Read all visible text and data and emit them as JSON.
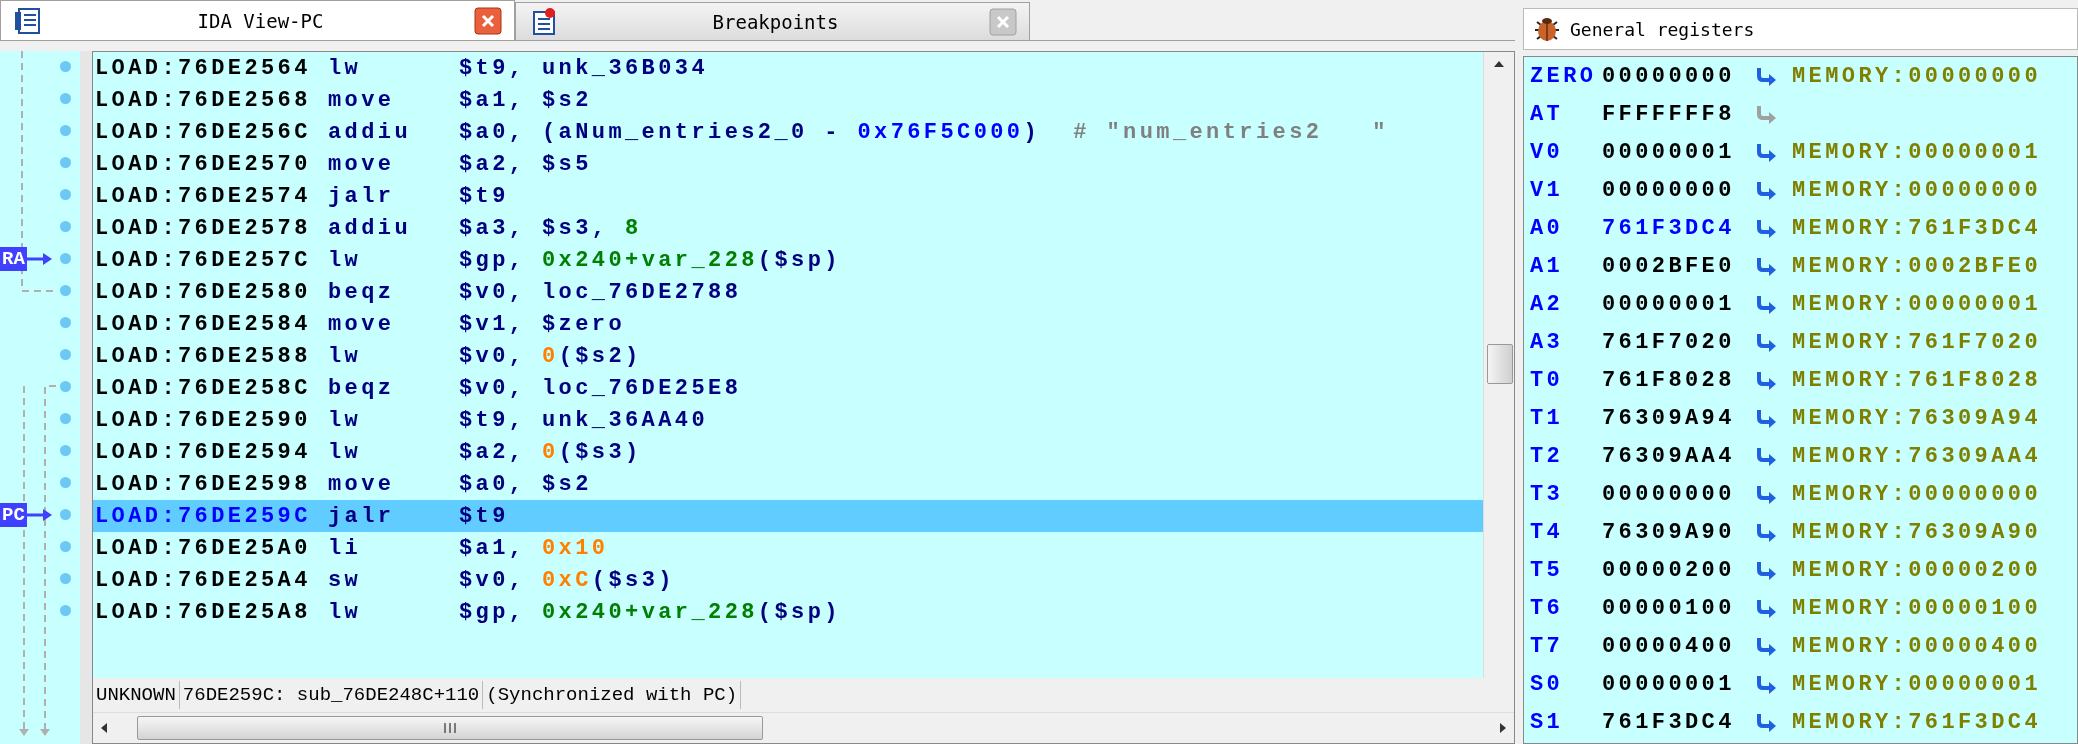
{
  "tabs": [
    {
      "label": "IDA View-PC",
      "selected": true
    },
    {
      "label": "Breakpoints",
      "selected": false
    }
  ],
  "listing": {
    "rows": [
      {
        "address": "LOAD:76DE2564",
        "mnemonic": "lw",
        "operands": [
          {
            "kind": "reg",
            "text": "$t9, unk_36B034"
          }
        ],
        "selected": false
      },
      {
        "address": "LOAD:76DE2568",
        "mnemonic": "move",
        "operands": [
          {
            "kind": "reg",
            "text": "$a1, $s2"
          }
        ],
        "selected": false
      },
      {
        "address": "LOAD:76DE256C",
        "mnemonic": "addiu",
        "operands": [
          {
            "kind": "reg",
            "text": "$a0, (aNum_entries2_0 - "
          },
          {
            "kind": "addr",
            "text": "0x76F5C000"
          },
          {
            "kind": "reg",
            "text": ")"
          },
          {
            "kind": "comment",
            "text": "  # \"num_entries2   \""
          }
        ],
        "selected": false
      },
      {
        "address": "LOAD:76DE2570",
        "mnemonic": "move",
        "operands": [
          {
            "kind": "reg",
            "text": "$a2, $s5"
          }
        ],
        "selected": false
      },
      {
        "address": "LOAD:76DE2574",
        "mnemonic": "jalr",
        "operands": [
          {
            "kind": "reg",
            "text": "$t9"
          }
        ],
        "selected": false
      },
      {
        "address": "LOAD:76DE2578",
        "mnemonic": "addiu",
        "operands": [
          {
            "kind": "reg",
            "text": "$a3, $s3, "
          },
          {
            "kind": "offset",
            "text": "8"
          }
        ],
        "selected": false
      },
      {
        "address": "LOAD:76DE257C",
        "mnemonic": "lw",
        "operands": [
          {
            "kind": "reg",
            "text": "$gp, "
          },
          {
            "kind": "offset",
            "text": "0x240+var_228"
          },
          {
            "kind": "reg",
            "text": "($sp)"
          }
        ],
        "selected": false,
        "marker": "RA"
      },
      {
        "address": "LOAD:76DE2580",
        "mnemonic": "beqz",
        "operands": [
          {
            "kind": "reg",
            "text": "$v0, loc_76DE2788"
          }
        ],
        "selected": false
      },
      {
        "address": "LOAD:76DE2584",
        "mnemonic": "move",
        "operands": [
          {
            "kind": "reg",
            "text": "$v1, $zero"
          }
        ],
        "selected": false
      },
      {
        "address": "LOAD:76DE2588",
        "mnemonic": "lw",
        "operands": [
          {
            "kind": "reg",
            "text": "$v0, "
          },
          {
            "kind": "num",
            "text": "0"
          },
          {
            "kind": "reg",
            "text": "($s2)"
          }
        ],
        "selected": false
      },
      {
        "address": "LOAD:76DE258C",
        "mnemonic": "beqz",
        "operands": [
          {
            "kind": "reg",
            "text": "$v0, loc_76DE25E8"
          }
        ],
        "selected": false
      },
      {
        "address": "LOAD:76DE2590",
        "mnemonic": "lw",
        "operands": [
          {
            "kind": "reg",
            "text": "$t9, unk_36AA40"
          }
        ],
        "selected": false
      },
      {
        "address": "LOAD:76DE2594",
        "mnemonic": "lw",
        "operands": [
          {
            "kind": "reg",
            "text": "$a2, "
          },
          {
            "kind": "num",
            "text": "0"
          },
          {
            "kind": "reg",
            "text": "($s3)"
          }
        ],
        "selected": false
      },
      {
        "address": "LOAD:76DE2598",
        "mnemonic": "move",
        "operands": [
          {
            "kind": "reg",
            "text": "$a0, $s2"
          }
        ],
        "selected": false
      },
      {
        "address": "LOAD:76DE259C",
        "mnemonic": "jalr",
        "operands": [
          {
            "kind": "reg",
            "text": "$t9"
          }
        ],
        "selected": true,
        "marker": "PC"
      },
      {
        "address": "LOAD:76DE25A0",
        "mnemonic": "li",
        "operands": [
          {
            "kind": "reg",
            "text": "$a1, "
          },
          {
            "kind": "num",
            "text": "0x10"
          }
        ],
        "selected": false
      },
      {
        "address": "LOAD:76DE25A4",
        "mnemonic": "sw",
        "operands": [
          {
            "kind": "reg",
            "text": "$v0, "
          },
          {
            "kind": "num",
            "text": "0xC"
          },
          {
            "kind": "reg",
            "text": "($s3)"
          }
        ],
        "selected": false
      },
      {
        "address": "LOAD:76DE25A8",
        "mnemonic": "lw",
        "operands": [
          {
            "kind": "reg",
            "text": "$gp, "
          },
          {
            "kind": "offset",
            "text": "0x240+var_228"
          },
          {
            "kind": "reg",
            "text": "($sp)"
          }
        ],
        "selected": false
      }
    ],
    "status": [
      "UNKNOWN",
      "76DE259C: sub_76DE248C+110",
      "(Synchronized with PC)"
    ]
  },
  "registers": {
    "title": "General registers",
    "rows": [
      {
        "name": "ZERO",
        "value": "00000000",
        "changed": false,
        "memory": "MEMORY:00000000"
      },
      {
        "name": "AT",
        "value": "FFFFFFF8",
        "changed": false
      },
      {
        "name": "V0",
        "value": "00000001",
        "changed": false,
        "memory": "MEMORY:00000001"
      },
      {
        "name": "V1",
        "value": "00000000",
        "changed": false,
        "memory": "MEMORY:00000000"
      },
      {
        "name": "A0",
        "value": "761F3DC4",
        "changed": true,
        "memory": "MEMORY:761F3DC4"
      },
      {
        "name": "A1",
        "value": "0002BFE0",
        "changed": false,
        "memory": "MEMORY:0002BFE0"
      },
      {
        "name": "A2",
        "value": "00000001",
        "changed": false,
        "memory": "MEMORY:00000001"
      },
      {
        "name": "A3",
        "value": "761F7020",
        "changed": false,
        "memory": "MEMORY:761F7020"
      },
      {
        "name": "T0",
        "value": "761F8028",
        "changed": false,
        "memory": "MEMORY:761F8028"
      },
      {
        "name": "T1",
        "value": "76309A94",
        "changed": false,
        "memory": "MEMORY:76309A94"
      },
      {
        "name": "T2",
        "value": "76309AA4",
        "changed": false,
        "memory": "MEMORY:76309AA4"
      },
      {
        "name": "T3",
        "value": "00000000",
        "changed": false,
        "memory": "MEMORY:00000000"
      },
      {
        "name": "T4",
        "value": "76309A90",
        "changed": false,
        "memory": "MEMORY:76309A90"
      },
      {
        "name": "T5",
        "value": "00000200",
        "changed": false,
        "memory": "MEMORY:00000200"
      },
      {
        "name": "T6",
        "value": "00000100",
        "changed": false,
        "memory": "MEMORY:00000100"
      },
      {
        "name": "T7",
        "value": "00000400",
        "changed": false,
        "memory": "MEMORY:00000400"
      },
      {
        "name": "S0",
        "value": "00000001",
        "changed": false,
        "memory": "MEMORY:00000001"
      },
      {
        "name": "S1",
        "value": "761F3DC4",
        "changed": false,
        "memory": "MEMORY:761F3DC4"
      }
    ]
  }
}
